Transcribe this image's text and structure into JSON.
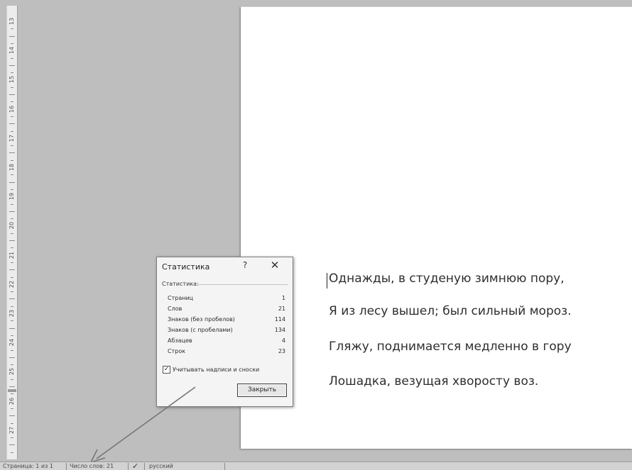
{
  "ruler": {
    "labels": [
      "13",
      "14",
      "15",
      "16",
      "17",
      "18",
      "19",
      "20",
      "21",
      "22",
      "23",
      "24",
      "25",
      "26",
      "27"
    ]
  },
  "document": {
    "lines": [
      "Однажды, в студеную зимнюю пору,",
      "Я из лесу вышел; был сильный мороз.",
      "Гляжу, поднимается медленно в гору",
      "Лошадка, везущая хворосту воз."
    ]
  },
  "dialog": {
    "title": "Статистика",
    "help": "?",
    "close": "✕",
    "group_label": "Статистика:",
    "rows": [
      {
        "label": "Страниц",
        "value": "1"
      },
      {
        "label": "Слов",
        "value": "21"
      },
      {
        "label": "Знаков (без пробелов)",
        "value": "114"
      },
      {
        "label": "Знаков (с пробелами)",
        "value": "134"
      },
      {
        "label": "Абзацев",
        "value": "4"
      },
      {
        "label": "Строк",
        "value": "23"
      }
    ],
    "checkbox": {
      "checked": true,
      "mark": "✓",
      "label": "Учитывать надписи и сноски"
    },
    "close_button": "Закрыть"
  },
  "statusbar": {
    "page": "Страница: 1 из 1",
    "words": "Число слов: 21",
    "language": "русский"
  }
}
